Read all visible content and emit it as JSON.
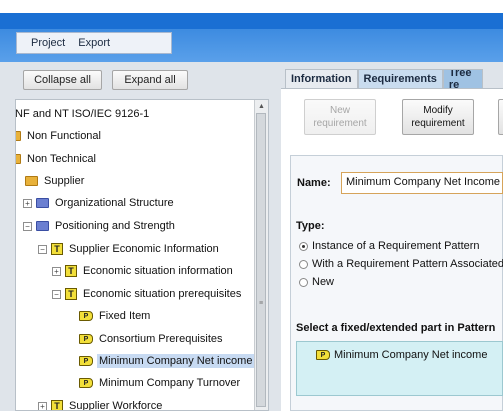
{
  "menu": {
    "items": [
      "Project",
      "Export"
    ]
  },
  "tree_toolbar": {
    "collapse_label": "Collapse all",
    "expand_label": "Expand all"
  },
  "tree": {
    "root": "NF and NT ISO/IEC 9126-1",
    "non_functional": "Non Functional",
    "non_technical": "Non Technical",
    "supplier": "Supplier",
    "org_structure": "Organizational Structure",
    "positioning": "Positioning and Strength",
    "supplier_econ_info": "Supplier Economic Information",
    "econ_situation_info": "Economic situation information",
    "econ_situation_prereq": "Economic situation prerequisites",
    "fixed_item": "Fixed Item",
    "consortium": "Consortium Prerequisites",
    "min_net_income": "Minimum Company Net income",
    "min_turnover": "Minimum Company Turnover",
    "supplier_workforce": "Supplier Workforce",
    "tree_icon_letter": "T",
    "pattern_icon_letter": "P"
  },
  "tabs": {
    "information": "Information",
    "requirements": "Requirements",
    "tree": "Tree re"
  },
  "actions": {
    "new_line1": "New",
    "new_line2": "requirement",
    "modify_line1": "Modify",
    "modify_line2": "requirement"
  },
  "form": {
    "name_label": "Name:",
    "name_value": "Minimum Company Net Income",
    "type_label": "Type:",
    "type_option_instance": "Instance of a Requirement Pattern",
    "type_option_associated": "With a Requirement Pattern Associated",
    "type_option_new": "New",
    "part_label": "Select a fixed/extended part in Pattern",
    "part_item": "Minimum Company Net income"
  },
  "colors": {
    "accent_blue": "#1a6fd3",
    "selection": "#c7daf2",
    "part_box": "#d4f0f4",
    "folder": "#e8b13a"
  }
}
